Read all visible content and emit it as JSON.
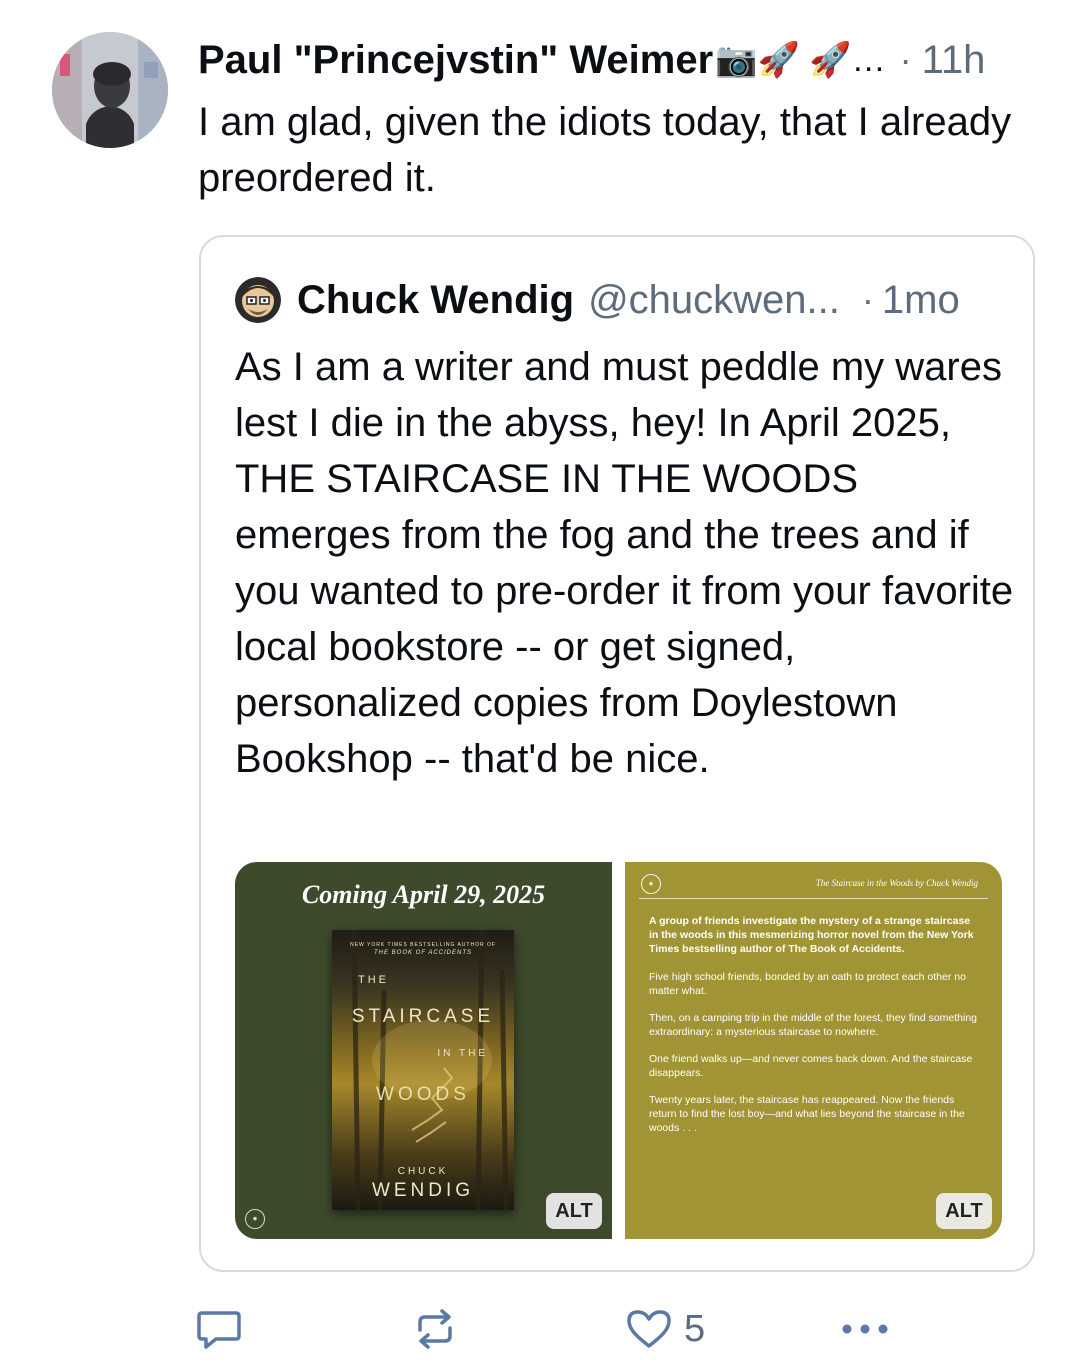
{
  "post": {
    "author_name": "Paul \"Princejvstin\" Weimer",
    "author_emoji": "📷🚀 🚀…",
    "separator": "·",
    "time": "11h",
    "text": "I am glad, given the idiots today, that I already preordered it."
  },
  "quote": {
    "author_name": "Chuck Wendig",
    "handle": "@chuckwen...",
    "separator": "·",
    "time": "1mo",
    "text": "As I am a writer and must peddle my wares lest I die in the abyss, hey! In April 2025, THE STAIRCASE IN THE WOODS emerges from the fog and the trees and if you wanted to pre-order it from your favorite local bookstore -- or get signed, personalized copies from Doylestown Bookshop -- that'd be nice.",
    "images": [
      {
        "alt_label": "ALT",
        "headline": "Coming April 29, 2025",
        "book": {
          "tagline": "NEW YORK TIMES BESTSELLING AUTHOR OF",
          "prev_title": "THE BOOK OF ACCIDENTS",
          "title_the": "THE",
          "title_staircase": "STAIRCASE",
          "title_in_the": "IN THE",
          "title_woods": "WOODS",
          "author_first": "CHUCK",
          "author_last": "WENDIG"
        }
      },
      {
        "alt_label": "ALT",
        "header": "The Staircase in the Woods by Chuck Wendig",
        "lead": "A group of friends investigate the mystery of a strange staircase in the woods in this mesmerizing horror novel from the New York Times bestselling author of The Book of Accidents.",
        "paragraphs": [
          "Five high school friends, bonded by an oath to protect each other no matter what.",
          "Then, on a camping trip in the middle of the forest, they find something extraordinary: a mysterious staircase to nowhere.",
          "One friend walks up—and never comes back down. And the staircase disappears.",
          "Twenty years later, the staircase has reappeared. Now the friends return to find the lost boy—and what lies beyond the staircase in the woods . . ."
        ]
      }
    ]
  },
  "actions": {
    "reply_icon": "reply-icon",
    "repost_icon": "repost-icon",
    "like_icon": "heart-icon",
    "like_count": "5",
    "more_icon": "more-icon"
  },
  "colors": {
    "text": "#0b0f14",
    "muted": "#5c6b7e",
    "border": "#d4dbe2",
    "image_left_bg": "#3d4a2b",
    "image_right_bg": "#a09434"
  }
}
